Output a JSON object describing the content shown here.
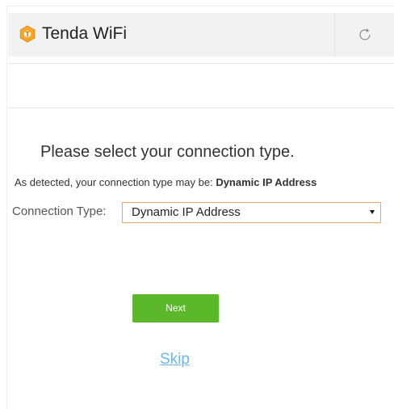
{
  "header": {
    "app_title": "Tenda WiFi",
    "logo_icon": "tenda-logo-icon",
    "refresh_icon": "refresh-icon"
  },
  "main": {
    "heading": "Please select your connection type.",
    "detected_prefix": "As detected, your connection type may be: ",
    "detected_value": "Dynamic IP Address",
    "connection_type_label": "Connection Type:",
    "connection_type_selected": "Dynamic IP Address",
    "next_label": "Next",
    "skip_label": "Skip"
  },
  "colors": {
    "accent_orange": "#f2a36b",
    "button_green": "#5ab82a",
    "link_blue": "#6fb6e6",
    "header_bg": "#f2f2f2"
  }
}
